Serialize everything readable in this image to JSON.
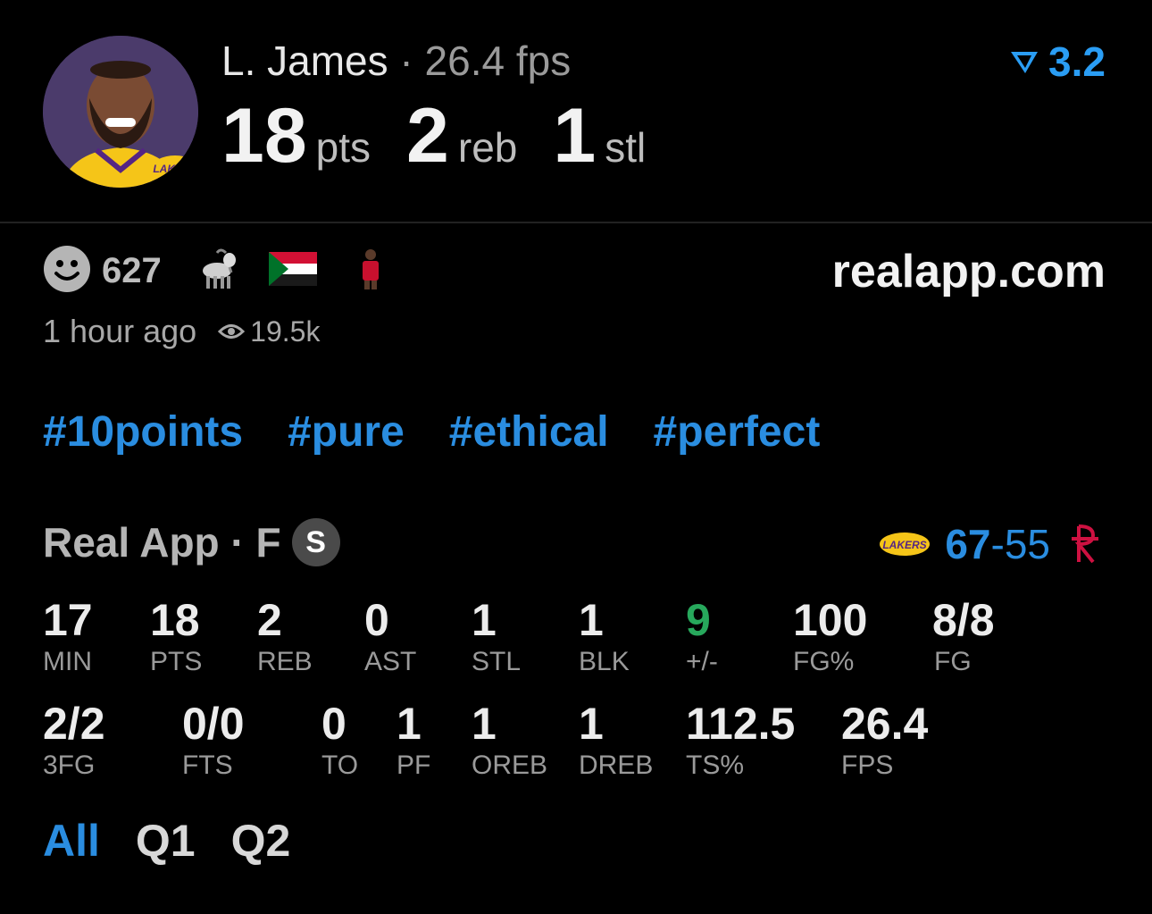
{
  "header": {
    "player_name": "L. James",
    "separator": " · ",
    "fps_text": "26.4 fps",
    "stats": [
      {
        "value": "18",
        "unit": "pts"
      },
      {
        "value": "2",
        "unit": "reb"
      },
      {
        "value": "1",
        "unit": "stl"
      }
    ],
    "rating": "3.2",
    "team_badge": "LAKERS"
  },
  "reactions": {
    "count": "627",
    "icons": [
      "smiley-icon",
      "goat-icon",
      "flag-icon",
      "player-figure-icon"
    ]
  },
  "site": "realapp.com",
  "meta": {
    "time": "1 hour ago",
    "views": "19.5k"
  },
  "hashtags": [
    "#10points",
    "#pure",
    "#ethical",
    "#perfect"
  ],
  "game": {
    "label": "Real App · F",
    "badge": "S",
    "home_logo_text": "LAKERS",
    "home_score": "67",
    "dash": "-",
    "away_score": "55"
  },
  "stats_row1": [
    {
      "value": "17",
      "label": "MIN"
    },
    {
      "value": "18",
      "label": "PTS"
    },
    {
      "value": "2",
      "label": "REB"
    },
    {
      "value": "0",
      "label": "AST"
    },
    {
      "value": "1",
      "label": "STL"
    },
    {
      "value": "1",
      "label": "BLK"
    },
    {
      "value": "9",
      "label": "+/-"
    },
    {
      "value": "100",
      "label": "FG%"
    },
    {
      "value": "8/8",
      "label": "FG"
    }
  ],
  "stats_row2": [
    {
      "value": "2/2",
      "label": "3FG"
    },
    {
      "value": "0/0",
      "label": "FTS"
    },
    {
      "value": "0",
      "label": "TO"
    },
    {
      "value": "1",
      "label": "PF"
    },
    {
      "value": "1",
      "label": "OREB"
    },
    {
      "value": "1",
      "label": "DREB"
    },
    {
      "value": "112.5",
      "label": "TS%"
    },
    {
      "value": "26.4",
      "label": "FPS"
    }
  ],
  "tabs": [
    "All",
    "Q1",
    "Q2"
  ],
  "colors": {
    "accent": "#2a8de0",
    "positive": "#27a85c",
    "background": "#000000",
    "rockets_red": "#ce1141"
  }
}
